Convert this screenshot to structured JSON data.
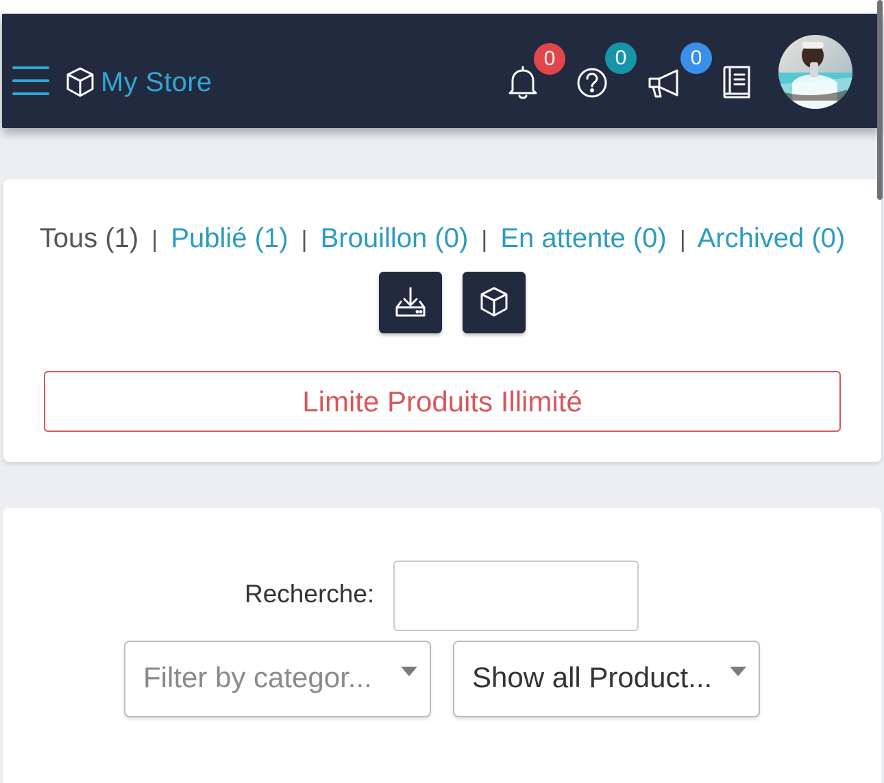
{
  "header": {
    "app_title": "My Store",
    "notifications": {
      "count": "0",
      "badge_color": "#e2454b"
    },
    "help": {
      "count": "0",
      "badge_color": "#1795a8"
    },
    "announcements": {
      "count": "0",
      "badge_color": "#3a8fe8"
    }
  },
  "status_filters": {
    "all": "Tous (1)",
    "published": "Publié (1)",
    "draft": "Brouillon (0)",
    "pending": "En attente (0)",
    "archived": "Archived (0)",
    "separator": "|"
  },
  "limit_notice": "Limite Produits Illimité",
  "search": {
    "label": "Recherche:",
    "value": ""
  },
  "category_filter": {
    "placeholder": "Filter by categor..."
  },
  "product_filter": {
    "selected": "Show all Product..."
  },
  "colors": {
    "header_bg": "#222a3f",
    "accent": "#2fa8d6",
    "link": "#2a9cbf",
    "danger": "#d9565a"
  }
}
